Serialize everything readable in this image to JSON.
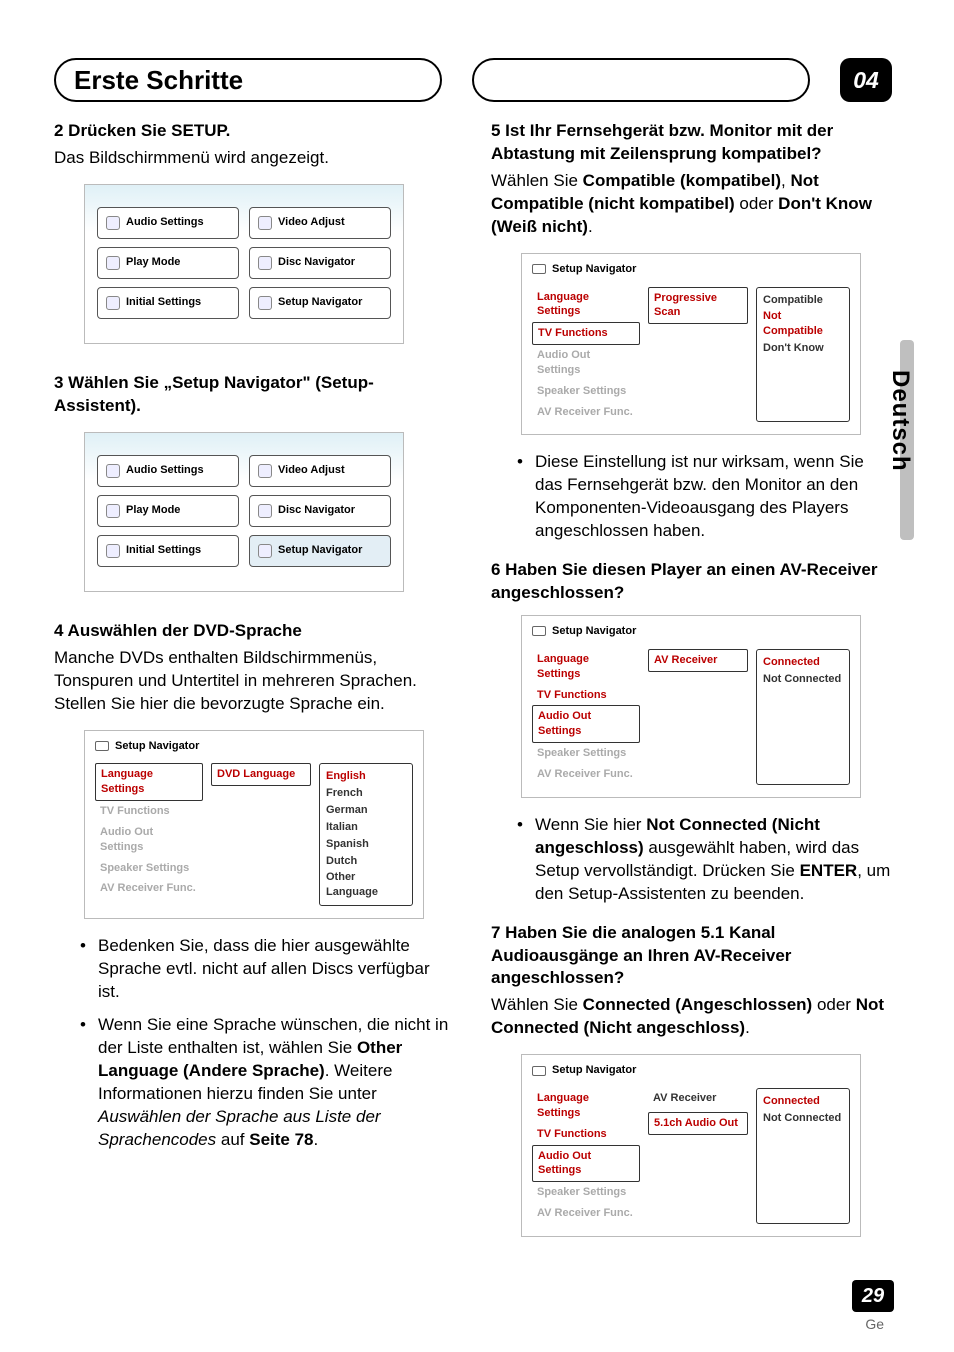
{
  "header": {
    "chapter_title": "Erste Schritte",
    "chapter_number": "04"
  },
  "side_tab": "Deutsch",
  "footer": {
    "page_number": "29",
    "lang_code": "Ge"
  },
  "left": {
    "step2": {
      "heading": "2   Drücken Sie SETUP.",
      "body": "Das Bildschirmmenü wird angezeigt."
    },
    "tiles": {
      "r1c1": "Audio Settings",
      "r1c2": "Video Adjust",
      "r2c1": "Play Mode",
      "r2c2": "Disc Navigator",
      "r3c1": "Initial Settings",
      "r3c2": "Setup Navigator"
    },
    "step3": {
      "heading": "3   Wählen Sie „Setup Navigator\" (Setup-Assistent)."
    },
    "step4": {
      "heading": "4   Auswählen der DVD-Sprache",
      "body": "Manche DVDs enthalten Bildschirmmenüs, Tonspuren und Untertitel in mehreren Sprachen. Stellen Sie hier die bevorzugte Sprache ein."
    },
    "nav1": {
      "title": "Setup Navigator",
      "left_items": [
        "Language Settings",
        "TV Functions",
        "Audio Out Settings",
        "Speaker Settings",
        "AV Receiver Func."
      ],
      "left_active_index": 0,
      "mid": "DVD Language",
      "right_items": [
        "English",
        "French",
        "German",
        "Italian",
        "Spanish",
        "Dutch",
        "Other Language"
      ]
    },
    "bullets": {
      "b1": "Bedenken Sie, dass die hier ausgewählte Sprache evtl. nicht auf allen Discs verfügbar ist.",
      "b2_pre": "Wenn Sie eine Sprache wünschen, die nicht in der Liste enthalten ist, wählen Sie ",
      "b2_bold": "Other Language (Andere Sprache)",
      "b2_mid": ". Weitere Informationen hierzu finden Sie unter ",
      "b2_italic": "Auswählen der Sprache aus Liste der Sprachencodes",
      "b2_after": " auf ",
      "b2_page": "Seite 78",
      "b2_end": "."
    }
  },
  "right": {
    "step5": {
      "heading": "5   Ist Ihr Fernsehgerät bzw. Monitor mit der Abtastung mit Zeilensprung kompatibel?",
      "body_pre": "Wählen Sie ",
      "b1": "Compatible (kompatibel)",
      "sep1": ", ",
      "b2": "Not Compatible (nicht kompatibel)",
      "sep2": " oder ",
      "b3": "Don't Know (Weiß nicht)",
      "end": "."
    },
    "nav2": {
      "title": "Setup Navigator",
      "left_items": [
        "Language Settings",
        "TV Functions",
        "Audio Out Settings",
        "Speaker Settings",
        "AV Receiver Func."
      ],
      "left_active_index": 1,
      "mid": "Progressive Scan",
      "right_items": [
        "Compatible",
        "Not Compatible",
        "Don't Know"
      ]
    },
    "bullet5": "Diese Einstellung ist nur wirksam, wenn Sie das Fernsehgerät bzw. den Monitor an den Komponenten-Videoausgang des Players angeschlossen haben.",
    "step6": {
      "heading": "6   Haben Sie diesen Player an einen AV-Receiver angeschlossen?"
    },
    "nav3": {
      "title": "Setup Navigator",
      "left_items": [
        "Language Settings",
        "TV Functions",
        "Audio Out Settings",
        "Speaker Settings",
        "AV Receiver Func."
      ],
      "left_active_index": 2,
      "mid": "AV Receiver",
      "right_items": [
        "Connected",
        "Not Connected"
      ]
    },
    "bullet6_pre": "Wenn Sie hier ",
    "bullet6_b1": "Not Connected (Nicht angeschloss)",
    "bullet6_mid": " ausgewählt haben, wird das Setup vervollständigt. Drücken Sie ",
    "bullet6_b2": "ENTER",
    "bullet6_end": ", um den Setup-Assistenten zu beenden.",
    "step7": {
      "heading": "7   Haben Sie die analogen 5.1 Kanal Audioausgänge an Ihren AV-Receiver angeschlossen?",
      "body_pre": "Wählen Sie ",
      "b1": "Connected (Angeschlossen)",
      "sep": " oder ",
      "b2": "Not Connected (Nicht angeschloss)",
      "end": "."
    },
    "nav4": {
      "title": "Setup Navigator",
      "left_items": [
        "Language Settings",
        "TV Functions",
        "Audio Out Settings",
        "Speaker Settings",
        "AV Receiver Func."
      ],
      "left_active_index": 2,
      "mid1": "AV Receiver",
      "mid2": "5.1ch Audio Out",
      "right_items": [
        "Connected",
        "Not Connected"
      ]
    }
  }
}
